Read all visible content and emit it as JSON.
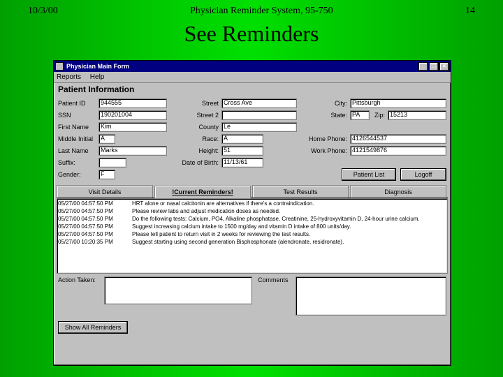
{
  "slide": {
    "date": "10/3/00",
    "header": "Physician Reminder System, 95-750",
    "page": "14",
    "title": "See Reminders"
  },
  "window": {
    "title": "Physician Main Form",
    "menu": {
      "reports": "Reports",
      "help": "Help"
    },
    "section": "Patient Information",
    "labels": {
      "patientId": "Patient ID",
      "ssn": "SSN",
      "firstName": "First Name",
      "middleInit": "Middle Initial",
      "lastName": "Last Name",
      "suffix": "Suffix:",
      "gender": "Gender:",
      "street": "Street",
      "street2": "Street 2",
      "county": "County",
      "race": "Race:",
      "height": "Height:",
      "dob": "Date of Birth:",
      "city": "City:",
      "state": "State:",
      "zip": "Zip:",
      "homePhone": "Home Phone:",
      "workPhone": "Work Phone:",
      "actionTaken": "Action Taken:",
      "comments": "Comments"
    },
    "fields": {
      "patientId": "944555",
      "ssn": "190201004",
      "firstName": "Kim",
      "middleInit": "A",
      "lastName": "Marks",
      "suffix": "",
      "gender": "F",
      "street": "Cross Ave",
      "street2": "",
      "county": "Le",
      "race": "A",
      "height": "51",
      "dob": "11/13/61",
      "city": "Pittsburgh",
      "state": "PA",
      "zip": "15213",
      "homePhone": "4126544537",
      "workPhone": "4121549876",
      "actionTaken": "",
      "comments": ""
    },
    "buttons": {
      "patientList": "Patient List",
      "logoff": "Logoff",
      "showAll": "Show All Reminders"
    },
    "tabs": {
      "visitDetails": "Visit Details",
      "currentReminders": "!Current Reminders!",
      "testResults": "Test Results",
      "diagnosis": "Diagnosis"
    },
    "reminders": [
      {
        "ts": "05/27/00 04:57:50 PM",
        "msg": "HRT alone or nasal calcitonin are alternatives if there's a contraindication."
      },
      {
        "ts": "05/27/00 04:57:50 PM",
        "msg": "Please review labs and adjust medication doses as needed."
      },
      {
        "ts": "05/27/00 04:57:50 PM",
        "msg": "Do the following tests: Calcium, PO4, Alkaline phosphatase, Creatinine, 25-hydroxyvitamin D, 24-hour urine calcium."
      },
      {
        "ts": "05/27/00 04:57:50 PM",
        "msg": "Suggest increasing calcium intake to 1500 mg/day and vitamin D intake of 800 units/day."
      },
      {
        "ts": "05/27/00 04:57:50 PM",
        "msg": "Please tell patient to return visit in 2 weeks for reviewing the test results."
      },
      {
        "ts": "05/27/00 10:20:35 PM",
        "msg": "Suggest starting using second generation Bisphosphonate (alendronate, residronate)."
      }
    ]
  }
}
